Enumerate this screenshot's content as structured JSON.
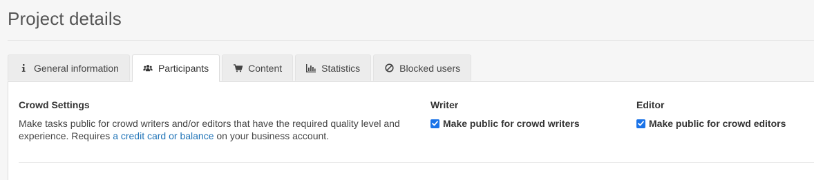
{
  "page": {
    "title": "Project details"
  },
  "tabs": [
    {
      "label": "General information",
      "icon": "info-icon",
      "active": false
    },
    {
      "label": "Participants",
      "icon": "users-icon",
      "active": true
    },
    {
      "label": "Content",
      "icon": "cart-icon",
      "active": false
    },
    {
      "label": "Statistics",
      "icon": "bar-chart-icon",
      "active": false
    },
    {
      "label": "Blocked users",
      "icon": "ban-icon",
      "active": false
    }
  ],
  "crowd_settings": {
    "title": "Crowd Settings",
    "description_before": "Make tasks public for crowd writers and/or editors that have the required quality level and experience. Requires ",
    "link_text": "a credit card or balance",
    "description_after": " on your business account."
  },
  "writer": {
    "title": "Writer",
    "checkbox_label": "Make public for crowd writers",
    "checked": true
  },
  "editor": {
    "title": "Editor",
    "checkbox_label": "Make public for crowd editors",
    "checked": true
  },
  "colors": {
    "link": "#1f73b7",
    "checkbox": "#1a73e8",
    "background": "#f6f6f6",
    "panel": "#ffffff"
  }
}
